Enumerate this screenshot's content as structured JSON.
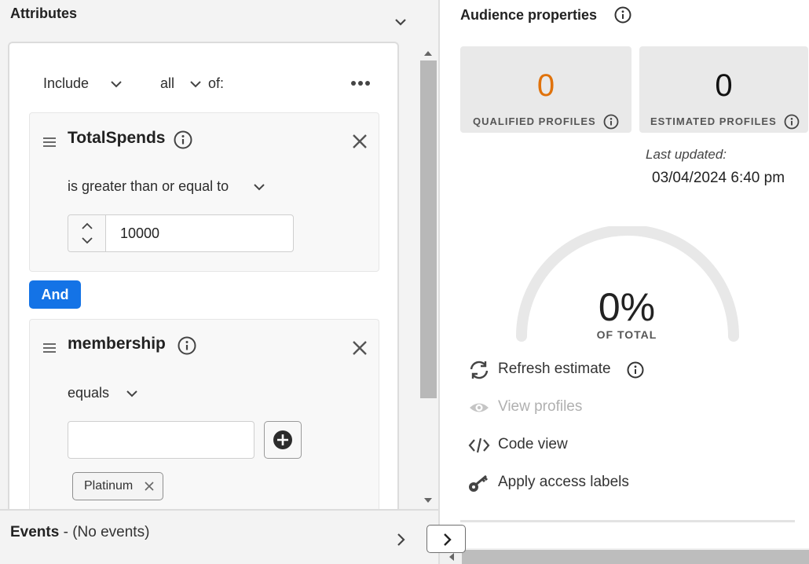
{
  "attributes": {
    "title": "Attributes",
    "include_label": "Include",
    "quantifier_label": "all",
    "of_label": "of:",
    "conditions": [
      {
        "name": "TotalSpends",
        "operator": "is greater than or equal to",
        "value": "10000"
      },
      {
        "name": "membership",
        "operator": "equals",
        "input_value": "",
        "tags": [
          "Platinum"
        ]
      }
    ],
    "and_label": "And"
  },
  "events": {
    "title": "Events",
    "subtitle": " - (No events)"
  },
  "audience_properties": {
    "title": "Audience properties",
    "qualified": {
      "value": "0",
      "label": "QUALIFIED PROFILES",
      "color": "#e0720b"
    },
    "estimated": {
      "value": "0",
      "label": "ESTIMATED PROFILES"
    },
    "last_updated_label": "Last updated:",
    "last_updated_value": "03/04/2024 6:40 pm",
    "percent": "0%",
    "percent_label": "OF TOTAL",
    "actions": {
      "refresh": "Refresh estimate",
      "view": "View profiles",
      "code": "Code view",
      "access": "Apply access labels"
    }
  },
  "icons": [
    "chevron-down-icon",
    "more-icon",
    "drag-handle-icon",
    "info-icon",
    "close-icon",
    "stepper-icon",
    "add-icon",
    "refresh-icon",
    "eye-icon",
    "code-icon",
    "key-icon",
    "chevron-right-icon"
  ],
  "colors": {
    "accent": "#1473e6",
    "qualified": "#e0720b"
  }
}
